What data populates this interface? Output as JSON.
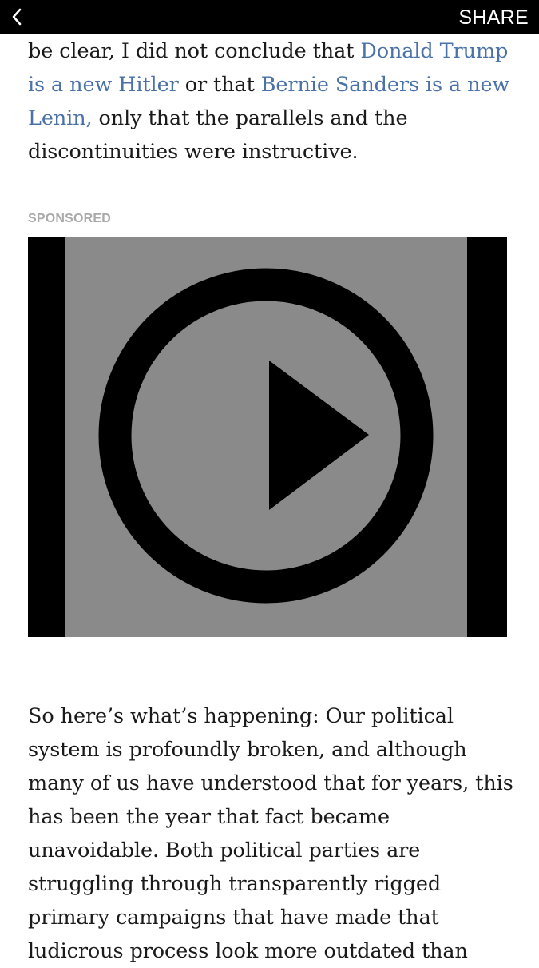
{
  "header": {
    "back_icon": "chevron-left-icon",
    "share_label": "SHARE"
  },
  "article": {
    "para1": {
      "t1": "be clear, I did not conclude that ",
      "link1": "Donald Trump is a new Hitler",
      "t2": " or that ",
      "link2": "Bernie Sanders is a new Lenin,",
      "t3": " only that the parallels and the discontinuities were instructive."
    },
    "sponsored_label": "SPONSORED",
    "video": {
      "icon": "play-circle-icon"
    },
    "para2": "So here’s what’s happening: Our political system is profoundly broken, and although many of us have understood that for years, this has been the year that fact became unavoidable. Both political parties are struggling through transparently rigged primary campaigns that have made that ludicrous process look more outdated than"
  },
  "colors": {
    "link": "#4a72a8",
    "topbar": "#000000",
    "video_placeholder": "#8a8a8a"
  }
}
